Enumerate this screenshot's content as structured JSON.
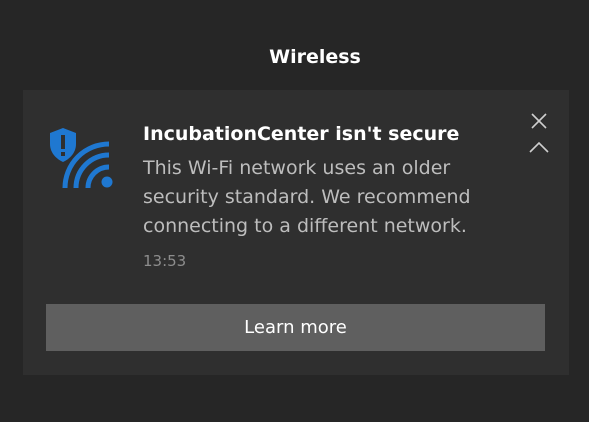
{
  "group": {
    "header": "Wireless"
  },
  "notification": {
    "icon": "wifi-shield-warning-icon",
    "title": "IncubationCenter isn't secure",
    "message": "This Wi-Fi network uses an older security standard. We recommend connecting to a different network.",
    "time": "13:53",
    "action_label": "Learn more",
    "controls": {
      "close_icon": "close-icon",
      "collapse_icon": "chevron-up-icon"
    }
  },
  "colors": {
    "background": "#262626",
    "toast": "#2f2f2f",
    "accent": "#1f78d1",
    "button": "#5f5f5f"
  }
}
